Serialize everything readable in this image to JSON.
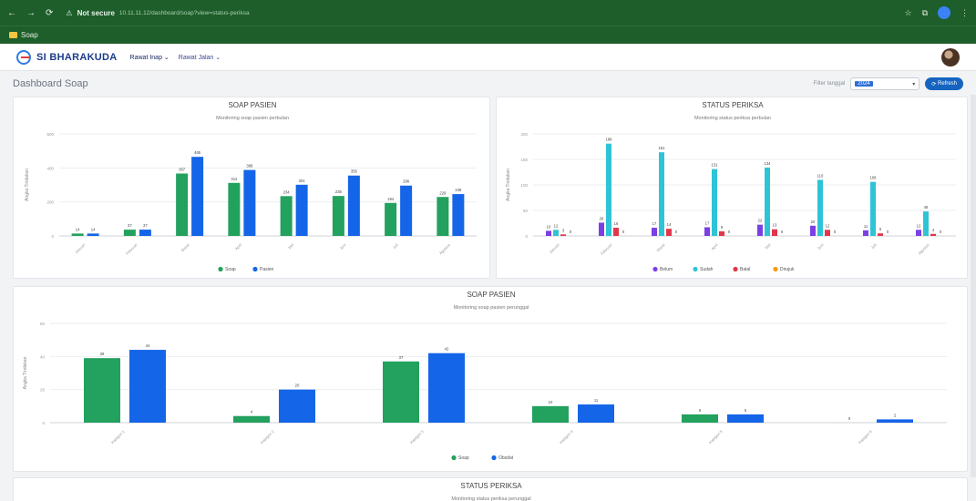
{
  "browser": {
    "secure_label": "Not secure",
    "url_text": "10.11.11.12/dashboard/soap?view=status-periksa"
  },
  "bookmarks": {
    "label": "Soap"
  },
  "app": {
    "brand": "SI BHARAKUDA",
    "nav": [
      "Rawat Inap",
      "Rawat Jalan"
    ]
  },
  "toolbar": {
    "title": "Dashboard Soap",
    "filter_text": "Filter tanggal",
    "select_value": "2024",
    "refresh_label": "Refresh"
  },
  "colors": {
    "green": "#23a15e",
    "blue": "#1565e8",
    "purple": "#7b3fe4",
    "cyan": "#2ec4d6",
    "red": "#e2364a",
    "orange": "#f39c12"
  },
  "chart_data": [
    {
      "type": "bar",
      "title": "SOAP PASIEN",
      "subtitle": "Monitoring soap pasien perbulan",
      "ylabel": "Angka Tindakan",
      "ylim": [
        0,
        600
      ],
      "yticks": [
        0,
        200,
        400,
        600
      ],
      "categories": [
        "Januari",
        "Februari",
        "Maret",
        "April",
        "Mei",
        "Juni",
        "Juli",
        "Agustus"
      ],
      "series": [
        {
          "name": "Soap",
          "color": "#23a15e",
          "values": [
            14,
            37,
            367,
            312,
            234,
            235,
            194,
            229
          ]
        },
        {
          "name": "Pasien",
          "color": "#1565e8",
          "values": [
            14,
            37,
            465,
            388,
            301,
            355,
            296,
            246
          ]
        }
      ]
    },
    {
      "type": "bar",
      "title": "STATUS PERIKSA",
      "subtitle": "Monitoring status periksa perbulan",
      "ylabel": "Angka Tindakan",
      "ylim": [
        0,
        200
      ],
      "yticks": [
        0,
        50,
        100,
        150,
        200
      ],
      "categories": [
        "Januari",
        "Februari",
        "Maret",
        "April",
        "Mei",
        "Juni",
        "Juli",
        "Agustus"
      ],
      "series": [
        {
          "name": "Belum",
          "color": "#7b3fe4",
          "values": [
            10,
            26,
            16,
            17,
            22,
            20,
            11,
            12
          ]
        },
        {
          "name": "Sudah",
          "color": "#2ec4d6",
          "values": [
            12,
            181,
            164,
            131,
            134,
            110,
            106,
            48
          ]
        },
        {
          "name": "Batal",
          "color": "#e2364a",
          "values": [
            3,
            16,
            14,
            9,
            13,
            12,
            5,
            4
          ]
        },
        {
          "name": "Dirujuk",
          "color": "#f39c12",
          "values": [
            0,
            0,
            0,
            0,
            0,
            0,
            0,
            0
          ]
        }
      ],
      "data_labels": [
        [
          "10",
          "12",
          "3",
          "0"
        ],
        [
          "26",
          "188",
          "16",
          "0"
        ],
        [
          "17",
          "161",
          "14",
          "0"
        ],
        [
          "17",
          "131",
          "9",
          "0"
        ],
        [
          "22",
          "134",
          "13",
          "0"
        ],
        [
          "20",
          "110",
          "12",
          "0"
        ],
        [
          "11",
          "106",
          "5",
          "0"
        ],
        [
          "12",
          "48",
          "4",
          "0"
        ]
      ]
    },
    {
      "type": "bar",
      "title": "SOAP PASIEN",
      "subtitle": "Monitoring soap pasien perunggal",
      "ylabel": "Angka Tindakan",
      "ylim": [
        0,
        60
      ],
      "yticks": [
        0,
        20,
        40,
        60
      ],
      "categories": [
        "Kategori 1",
        "Kategori 2",
        "Kategori 3",
        "Kategori 4",
        "Kategori 5",
        "Kategori 6"
      ],
      "series": [
        {
          "name": "Soap",
          "color": "#23a15e",
          "values": [
            39,
            4,
            37,
            10,
            5,
            0
          ]
        },
        {
          "name": "Obsdat",
          "color": "#1565e8",
          "values": [
            44,
            20,
            42,
            11,
            5,
            2
          ]
        }
      ]
    },
    {
      "type": "bar",
      "title": "STATUS PERIKSA",
      "subtitle": "Monitoring status periksa perunggal"
    }
  ]
}
